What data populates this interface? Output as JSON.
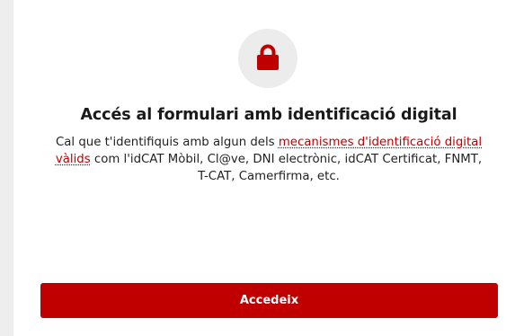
{
  "icon": {
    "name": "lock-icon",
    "color": "#c00000",
    "circle_color": "#ececec"
  },
  "title": "Accés al formulari amb identificació digital",
  "description": {
    "before_link": "Cal que t'identifiquis amb algun dels ",
    "link_text": "mecanismes d'identificació digital vàlids",
    "after_link": " com l'idCAT Mòbil, Cl@ve, DNI electrònic, idCAT Certificat, FNMT, T-CAT, Camerfirma, etc."
  },
  "button": {
    "label": "Accedeix",
    "color": "#c00000"
  }
}
